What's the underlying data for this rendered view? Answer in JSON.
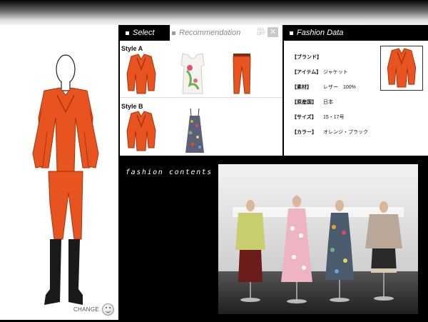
{
  "colors": {
    "accent_orange": "#e8541f",
    "black": "#000000",
    "white": "#ffffff"
  },
  "tabs": {
    "select_label": "Select",
    "recommendation_label": "Recommendation",
    "all_off_label": "ALL OFF"
  },
  "styles": [
    {
      "label": "Style A",
      "items": [
        "orange-leather-jacket",
        "floral-white-top",
        "orange-cropped-pants"
      ]
    },
    {
      "label": "Style B",
      "items": [
        "orange-leather-jacket",
        "patterned-strap-dress"
      ]
    }
  ],
  "fashion_data": {
    "title": "Fashion Data",
    "rows": [
      {
        "key": "【ブランド】",
        "value": ""
      },
      {
        "key": "【アイテム】",
        "value": "ジャケット"
      },
      {
        "key": "【素材】",
        "value": "レザー　100%"
      },
      {
        "key": "【原産国】",
        "value": "日本"
      },
      {
        "key": "【サイズ】",
        "value": "15・17号"
      },
      {
        "key": "【カラー】",
        "value": "オレンジ・ブラック"
      }
    ]
  },
  "contents": {
    "title": "fashion contents"
  },
  "mannequin": {
    "change_label": "CHANGE"
  }
}
